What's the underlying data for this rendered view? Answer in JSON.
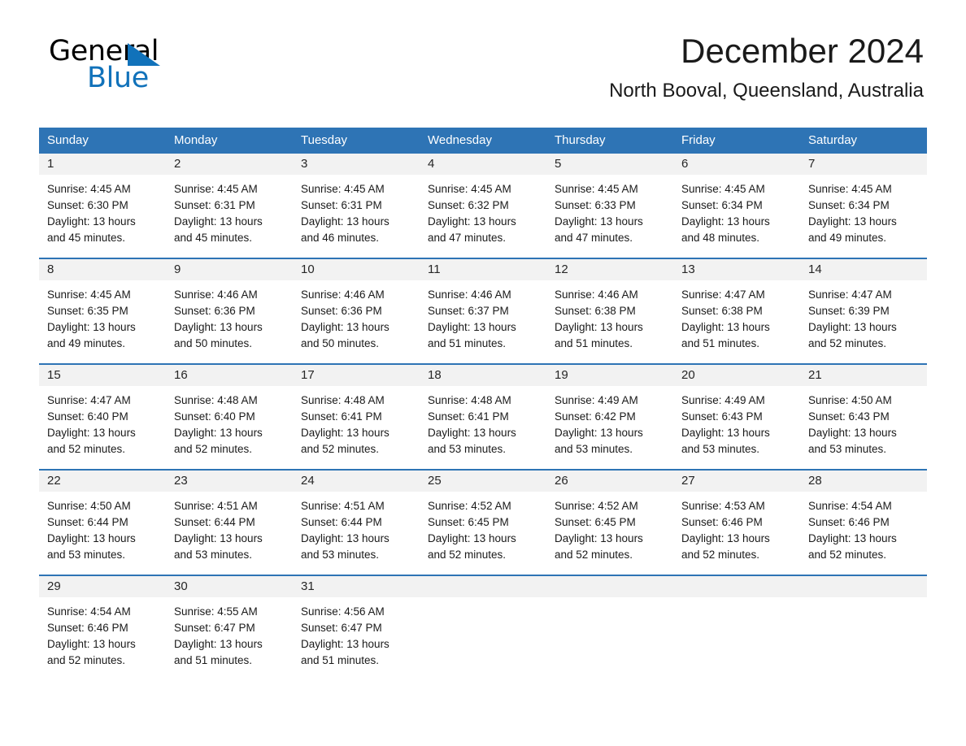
{
  "brand": {
    "name_dark": "General",
    "name_light": "Blue",
    "accent_color": "#1172ba"
  },
  "header": {
    "title": "December 2024",
    "subtitle": "North Booval, Queensland, Australia"
  },
  "colors": {
    "header_blue": "#2e74b5",
    "day_number_band": "#f2f2f2",
    "text": "#1a1a1a"
  },
  "weekdays": [
    "Sunday",
    "Monday",
    "Tuesday",
    "Wednesday",
    "Thursday",
    "Friday",
    "Saturday"
  ],
  "weeks": [
    [
      {
        "day": "1",
        "sunrise": "Sunrise: 4:45 AM",
        "sunset": "Sunset: 6:30 PM",
        "daylight_line1": "Daylight: 13 hours",
        "daylight_line2": "and 45 minutes."
      },
      {
        "day": "2",
        "sunrise": "Sunrise: 4:45 AM",
        "sunset": "Sunset: 6:31 PM",
        "daylight_line1": "Daylight: 13 hours",
        "daylight_line2": "and 45 minutes."
      },
      {
        "day": "3",
        "sunrise": "Sunrise: 4:45 AM",
        "sunset": "Sunset: 6:31 PM",
        "daylight_line1": "Daylight: 13 hours",
        "daylight_line2": "and 46 minutes."
      },
      {
        "day": "4",
        "sunrise": "Sunrise: 4:45 AM",
        "sunset": "Sunset: 6:32 PM",
        "daylight_line1": "Daylight: 13 hours",
        "daylight_line2": "and 47 minutes."
      },
      {
        "day": "5",
        "sunrise": "Sunrise: 4:45 AM",
        "sunset": "Sunset: 6:33 PM",
        "daylight_line1": "Daylight: 13 hours",
        "daylight_line2": "and 47 minutes."
      },
      {
        "day": "6",
        "sunrise": "Sunrise: 4:45 AM",
        "sunset": "Sunset: 6:34 PM",
        "daylight_line1": "Daylight: 13 hours",
        "daylight_line2": "and 48 minutes."
      },
      {
        "day": "7",
        "sunrise": "Sunrise: 4:45 AM",
        "sunset": "Sunset: 6:34 PM",
        "daylight_line1": "Daylight: 13 hours",
        "daylight_line2": "and 49 minutes."
      }
    ],
    [
      {
        "day": "8",
        "sunrise": "Sunrise: 4:45 AM",
        "sunset": "Sunset: 6:35 PM",
        "daylight_line1": "Daylight: 13 hours",
        "daylight_line2": "and 49 minutes."
      },
      {
        "day": "9",
        "sunrise": "Sunrise: 4:46 AM",
        "sunset": "Sunset: 6:36 PM",
        "daylight_line1": "Daylight: 13 hours",
        "daylight_line2": "and 50 minutes."
      },
      {
        "day": "10",
        "sunrise": "Sunrise: 4:46 AM",
        "sunset": "Sunset: 6:36 PM",
        "daylight_line1": "Daylight: 13 hours",
        "daylight_line2": "and 50 minutes."
      },
      {
        "day": "11",
        "sunrise": "Sunrise: 4:46 AM",
        "sunset": "Sunset: 6:37 PM",
        "daylight_line1": "Daylight: 13 hours",
        "daylight_line2": "and 51 minutes."
      },
      {
        "day": "12",
        "sunrise": "Sunrise: 4:46 AM",
        "sunset": "Sunset: 6:38 PM",
        "daylight_line1": "Daylight: 13 hours",
        "daylight_line2": "and 51 minutes."
      },
      {
        "day": "13",
        "sunrise": "Sunrise: 4:47 AM",
        "sunset": "Sunset: 6:38 PM",
        "daylight_line1": "Daylight: 13 hours",
        "daylight_line2": "and 51 minutes."
      },
      {
        "day": "14",
        "sunrise": "Sunrise: 4:47 AM",
        "sunset": "Sunset: 6:39 PM",
        "daylight_line1": "Daylight: 13 hours",
        "daylight_line2": "and 52 minutes."
      }
    ],
    [
      {
        "day": "15",
        "sunrise": "Sunrise: 4:47 AM",
        "sunset": "Sunset: 6:40 PM",
        "daylight_line1": "Daylight: 13 hours",
        "daylight_line2": "and 52 minutes."
      },
      {
        "day": "16",
        "sunrise": "Sunrise: 4:48 AM",
        "sunset": "Sunset: 6:40 PM",
        "daylight_line1": "Daylight: 13 hours",
        "daylight_line2": "and 52 minutes."
      },
      {
        "day": "17",
        "sunrise": "Sunrise: 4:48 AM",
        "sunset": "Sunset: 6:41 PM",
        "daylight_line1": "Daylight: 13 hours",
        "daylight_line2": "and 52 minutes."
      },
      {
        "day": "18",
        "sunrise": "Sunrise: 4:48 AM",
        "sunset": "Sunset: 6:41 PM",
        "daylight_line1": "Daylight: 13 hours",
        "daylight_line2": "and 53 minutes."
      },
      {
        "day": "19",
        "sunrise": "Sunrise: 4:49 AM",
        "sunset": "Sunset: 6:42 PM",
        "daylight_line1": "Daylight: 13 hours",
        "daylight_line2": "and 53 minutes."
      },
      {
        "day": "20",
        "sunrise": "Sunrise: 4:49 AM",
        "sunset": "Sunset: 6:43 PM",
        "daylight_line1": "Daylight: 13 hours",
        "daylight_line2": "and 53 minutes."
      },
      {
        "day": "21",
        "sunrise": "Sunrise: 4:50 AM",
        "sunset": "Sunset: 6:43 PM",
        "daylight_line1": "Daylight: 13 hours",
        "daylight_line2": "and 53 minutes."
      }
    ],
    [
      {
        "day": "22",
        "sunrise": "Sunrise: 4:50 AM",
        "sunset": "Sunset: 6:44 PM",
        "daylight_line1": "Daylight: 13 hours",
        "daylight_line2": "and 53 minutes."
      },
      {
        "day": "23",
        "sunrise": "Sunrise: 4:51 AM",
        "sunset": "Sunset: 6:44 PM",
        "daylight_line1": "Daylight: 13 hours",
        "daylight_line2": "and 53 minutes."
      },
      {
        "day": "24",
        "sunrise": "Sunrise: 4:51 AM",
        "sunset": "Sunset: 6:44 PM",
        "daylight_line1": "Daylight: 13 hours",
        "daylight_line2": "and 53 minutes."
      },
      {
        "day": "25",
        "sunrise": "Sunrise: 4:52 AM",
        "sunset": "Sunset: 6:45 PM",
        "daylight_line1": "Daylight: 13 hours",
        "daylight_line2": "and 52 minutes."
      },
      {
        "day": "26",
        "sunrise": "Sunrise: 4:52 AM",
        "sunset": "Sunset: 6:45 PM",
        "daylight_line1": "Daylight: 13 hours",
        "daylight_line2": "and 52 minutes."
      },
      {
        "day": "27",
        "sunrise": "Sunrise: 4:53 AM",
        "sunset": "Sunset: 6:46 PM",
        "daylight_line1": "Daylight: 13 hours",
        "daylight_line2": "and 52 minutes."
      },
      {
        "day": "28",
        "sunrise": "Sunrise: 4:54 AM",
        "sunset": "Sunset: 6:46 PM",
        "daylight_line1": "Daylight: 13 hours",
        "daylight_line2": "and 52 minutes."
      }
    ],
    [
      {
        "day": "29",
        "sunrise": "Sunrise: 4:54 AM",
        "sunset": "Sunset: 6:46 PM",
        "daylight_line1": "Daylight: 13 hours",
        "daylight_line2": "and 52 minutes."
      },
      {
        "day": "30",
        "sunrise": "Sunrise: 4:55 AM",
        "sunset": "Sunset: 6:47 PM",
        "daylight_line1": "Daylight: 13 hours",
        "daylight_line2": "and 51 minutes."
      },
      {
        "day": "31",
        "sunrise": "Sunrise: 4:56 AM",
        "sunset": "Sunset: 6:47 PM",
        "daylight_line1": "Daylight: 13 hours",
        "daylight_line2": "and 51 minutes."
      },
      {
        "day": "",
        "sunrise": "",
        "sunset": "",
        "daylight_line1": "",
        "daylight_line2": ""
      },
      {
        "day": "",
        "sunrise": "",
        "sunset": "",
        "daylight_line1": "",
        "daylight_line2": ""
      },
      {
        "day": "",
        "sunrise": "",
        "sunset": "",
        "daylight_line1": "",
        "daylight_line2": ""
      },
      {
        "day": "",
        "sunrise": "",
        "sunset": "",
        "daylight_line1": "",
        "daylight_line2": ""
      }
    ]
  ]
}
